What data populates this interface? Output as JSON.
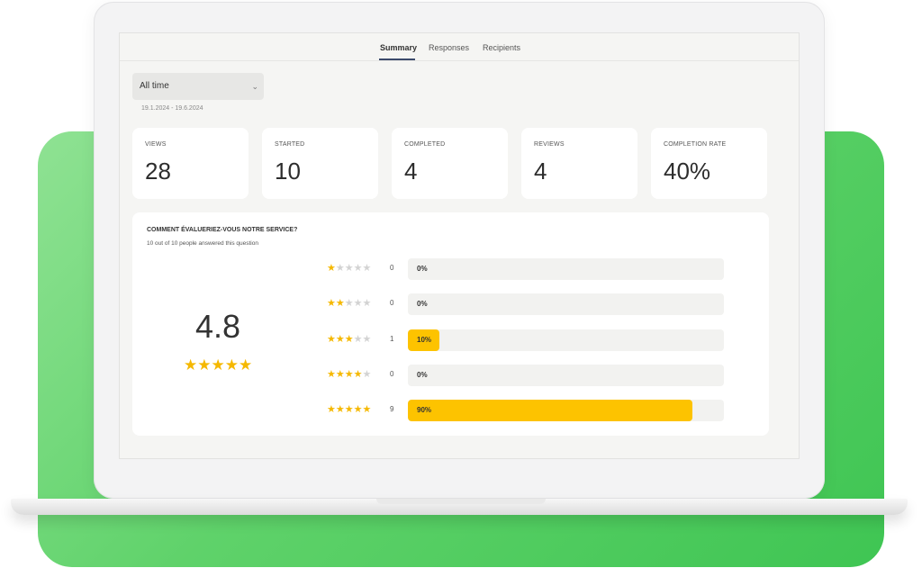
{
  "tabs": [
    {
      "label": "Summary",
      "active": true
    },
    {
      "label": "Responses",
      "active": false
    },
    {
      "label": "Recipients",
      "active": false
    }
  ],
  "filter": {
    "selected": "All time",
    "date_range": "19.1.2024 - 19.6.2024"
  },
  "stats": [
    {
      "label": "Views",
      "value": "28"
    },
    {
      "label": "Started",
      "value": "10"
    },
    {
      "label": "Completed",
      "value": "4"
    },
    {
      "label": "Reviews",
      "value": "4"
    },
    {
      "label": "Completion rate",
      "value": "40%"
    }
  ],
  "question": {
    "title": "COMMENT ÉVALUERIEZ-VOUS NOTRE SERVICE?",
    "answered": "10 out of 10 people answered this question",
    "average": "4.8",
    "average_stars": 5,
    "ratings": [
      {
        "stars": 1,
        "count": "0",
        "percent": "0%",
        "fraction": 0
      },
      {
        "stars": 2,
        "count": "0",
        "percent": "0%",
        "fraction": 0
      },
      {
        "stars": 3,
        "count": "1",
        "percent": "10%",
        "fraction": 0.1
      },
      {
        "stars": 4,
        "count": "0",
        "percent": "0%",
        "fraction": 0
      },
      {
        "stars": 5,
        "count": "9",
        "percent": "90%",
        "fraction": 0.9
      }
    ]
  },
  "colors": {
    "accent": "#fdc300",
    "star": "#f5b800",
    "background_shape": "#5fd26a"
  },
  "icons": {
    "dropdown": "chevron-down-icon",
    "star": "star-icon"
  }
}
